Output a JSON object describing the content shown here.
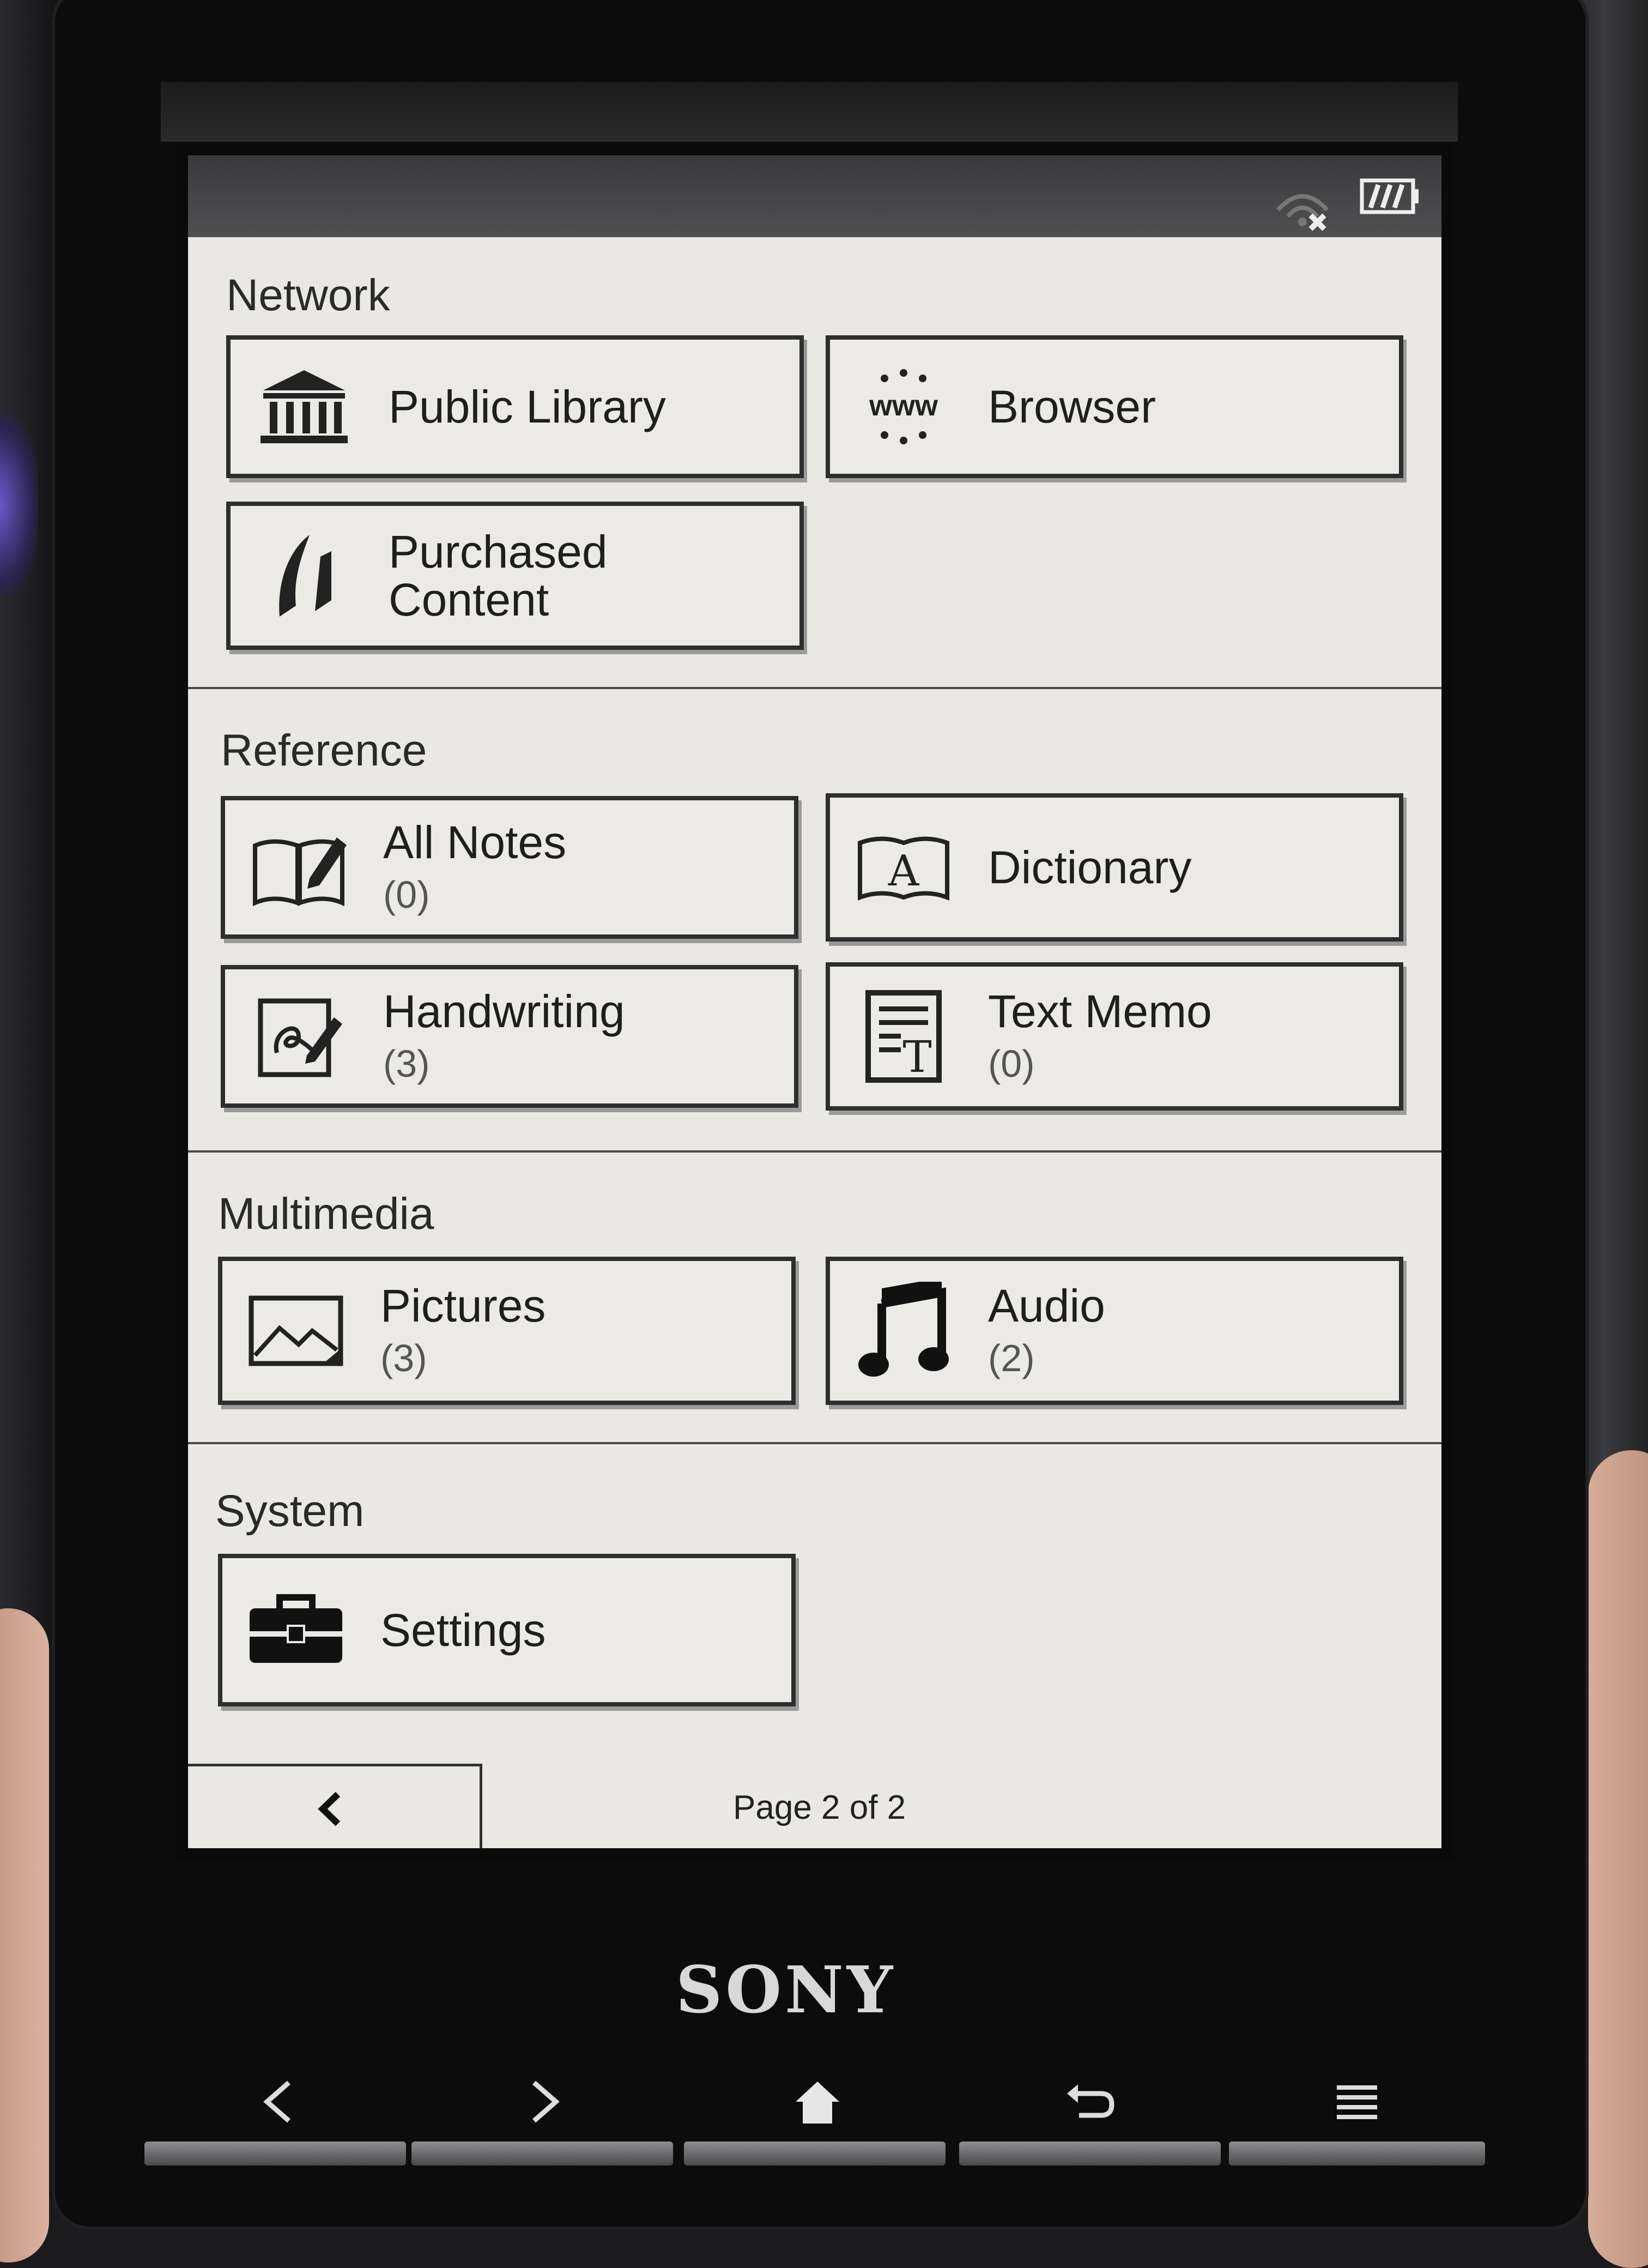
{
  "sections": {
    "network": {
      "title": "Network",
      "tiles": [
        {
          "label": "Public Library",
          "icon": "library-icon"
        },
        {
          "label": "Browser",
          "icon": "www-icon"
        },
        {
          "label": "Purchased Content",
          "icon": "bookmark-icon"
        }
      ]
    },
    "reference": {
      "title": "Reference",
      "tiles": [
        {
          "label": "All Notes",
          "count": "(0)",
          "icon": "notes-icon"
        },
        {
          "label": "Dictionary",
          "icon": "dictionary-icon"
        },
        {
          "label": "Handwriting",
          "count": "(3)",
          "icon": "handwriting-icon"
        },
        {
          "label": "Text Memo",
          "count": "(0)",
          "icon": "text-memo-icon"
        }
      ]
    },
    "multimedia": {
      "title": "Multimedia",
      "tiles": [
        {
          "label": "Pictures",
          "count": "(3)",
          "icon": "picture-icon"
        },
        {
          "label": "Audio",
          "count": "(2)",
          "icon": "music-note-icon"
        }
      ]
    },
    "system": {
      "title": "System",
      "tiles": [
        {
          "label": "Settings",
          "icon": "toolbox-icon"
        }
      ]
    }
  },
  "footer": {
    "page_indicator": "Page 2 of 2",
    "back_icon": "chevron-left-icon"
  },
  "device": {
    "brand": "SONY",
    "buttons": [
      "previous-icon",
      "next-icon",
      "home-icon",
      "return-icon",
      "menu-icon"
    ]
  },
  "colors": {
    "screen": "#e9e8e4",
    "bezel": "#0c0c0d",
    "ink": "#1e1e1e"
  }
}
